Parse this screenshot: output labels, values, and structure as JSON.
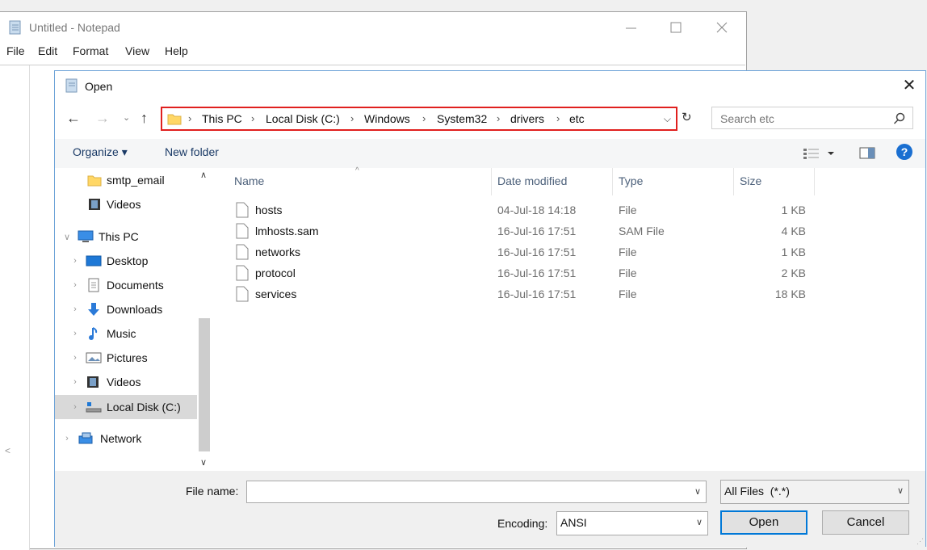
{
  "notepad": {
    "title": "Untitled - Notepad",
    "menu": [
      "File",
      "Edit",
      "Format",
      "View",
      "Help"
    ]
  },
  "dialog": {
    "title": "Open",
    "breadcrumb": [
      "This PC",
      "Local Disk (C:)",
      "Windows",
      "System32",
      "drivers",
      "etc"
    ],
    "search_placeholder": "Search etc",
    "toolbar": {
      "organize": "Organize ▾",
      "new_folder": "New folder"
    },
    "nav": [
      {
        "label": "smtp_email",
        "icon": "folder-icon",
        "level": 1
      },
      {
        "label": "Videos",
        "icon": "videos-icon",
        "level": 1
      },
      {
        "label": "This PC",
        "icon": "this-pc-icon",
        "level": 0,
        "expanded": true
      },
      {
        "label": "Desktop",
        "icon": "desktop-icon",
        "level": 1
      },
      {
        "label": "Documents",
        "icon": "documents-icon",
        "level": 1
      },
      {
        "label": "Downloads",
        "icon": "downloads-icon",
        "level": 1
      },
      {
        "label": "Music",
        "icon": "music-icon",
        "level": 1
      },
      {
        "label": "Pictures",
        "icon": "pictures-icon",
        "level": 1
      },
      {
        "label": "Videos",
        "icon": "videos-icon",
        "level": 1
      },
      {
        "label": "Local Disk (C:)",
        "icon": "local-disk-icon",
        "level": 1,
        "selected": true
      },
      {
        "label": "Network",
        "icon": "network-icon",
        "level": 0
      }
    ],
    "columns": {
      "name": "Name",
      "date": "Date modified",
      "type": "Type",
      "size": "Size"
    },
    "files": [
      {
        "name": "hosts",
        "date": "04-Jul-18 14:18",
        "type": "File",
        "size": "1 KB"
      },
      {
        "name": "lmhosts.sam",
        "date": "16-Jul-16 17:51",
        "type": "SAM File",
        "size": "4 KB"
      },
      {
        "name": "networks",
        "date": "16-Jul-16 17:51",
        "type": "File",
        "size": "1 KB"
      },
      {
        "name": "protocol",
        "date": "16-Jul-16 17:51",
        "type": "File",
        "size": "2 KB"
      },
      {
        "name": "services",
        "date": "16-Jul-16 17:51",
        "type": "File",
        "size": "18 KB"
      }
    ],
    "filename_label": "File name:",
    "filename_value": "",
    "filter": "All Files  (*.*)",
    "encoding_label": "Encoding:",
    "encoding_value": "ANSI",
    "open_button": "Open",
    "cancel_button": "Cancel"
  },
  "colors": {
    "accent": "#0078d7",
    "highlight_border": "#e0201e",
    "folder": "#ffd766"
  }
}
